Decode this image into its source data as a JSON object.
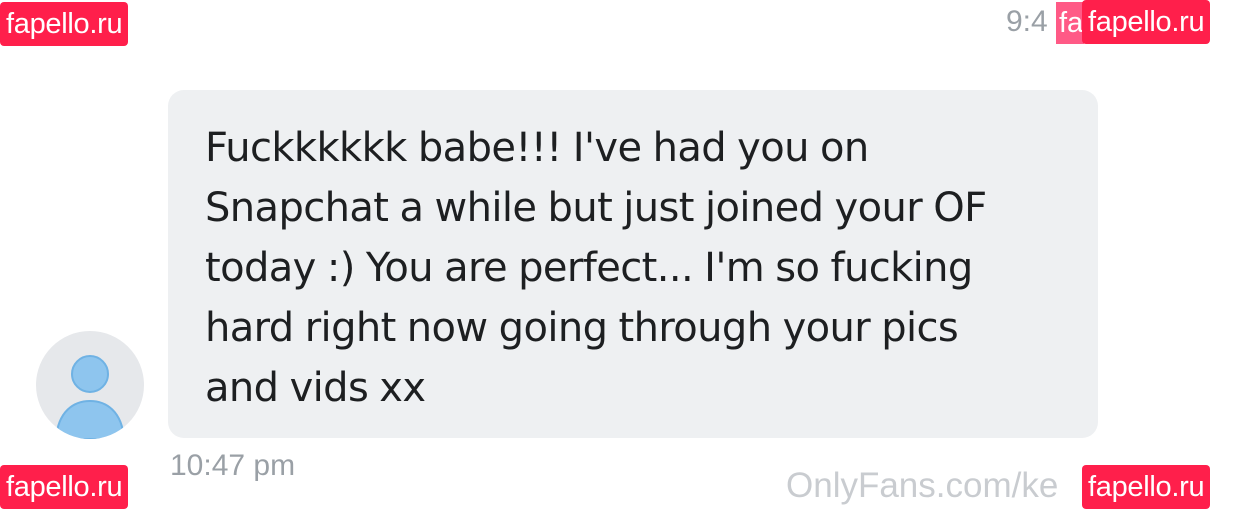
{
  "watermarks": {
    "top_left": "fapello.ru",
    "top_right": "fapello.ru",
    "bottom_left": "fapello.ru",
    "bottom_right": "fapello.ru"
  },
  "header": {
    "time_partial": "9:4",
    "time_partial_overlay": "fa"
  },
  "message": {
    "lines": [
      "Fuckkkkkk babe!!! I've had you on",
      "Snapchat a while but just joined your OF",
      "today :) You are perfect... I'm so fucking",
      "hard right now going through your pics",
      "and vids xx"
    ],
    "time": "10:47 pm"
  },
  "footer": {
    "site_watermark": "OnlyFans.com/ke"
  },
  "colors": {
    "bubble_background": "#eef0f2",
    "watermark_background": "#ff1f4b",
    "avatar_background": "#e6e8eb",
    "avatar_icon": "#8ec5ee",
    "timestamp": "#9aa0a6"
  },
  "icons": {
    "avatar": "user-placeholder-icon"
  }
}
